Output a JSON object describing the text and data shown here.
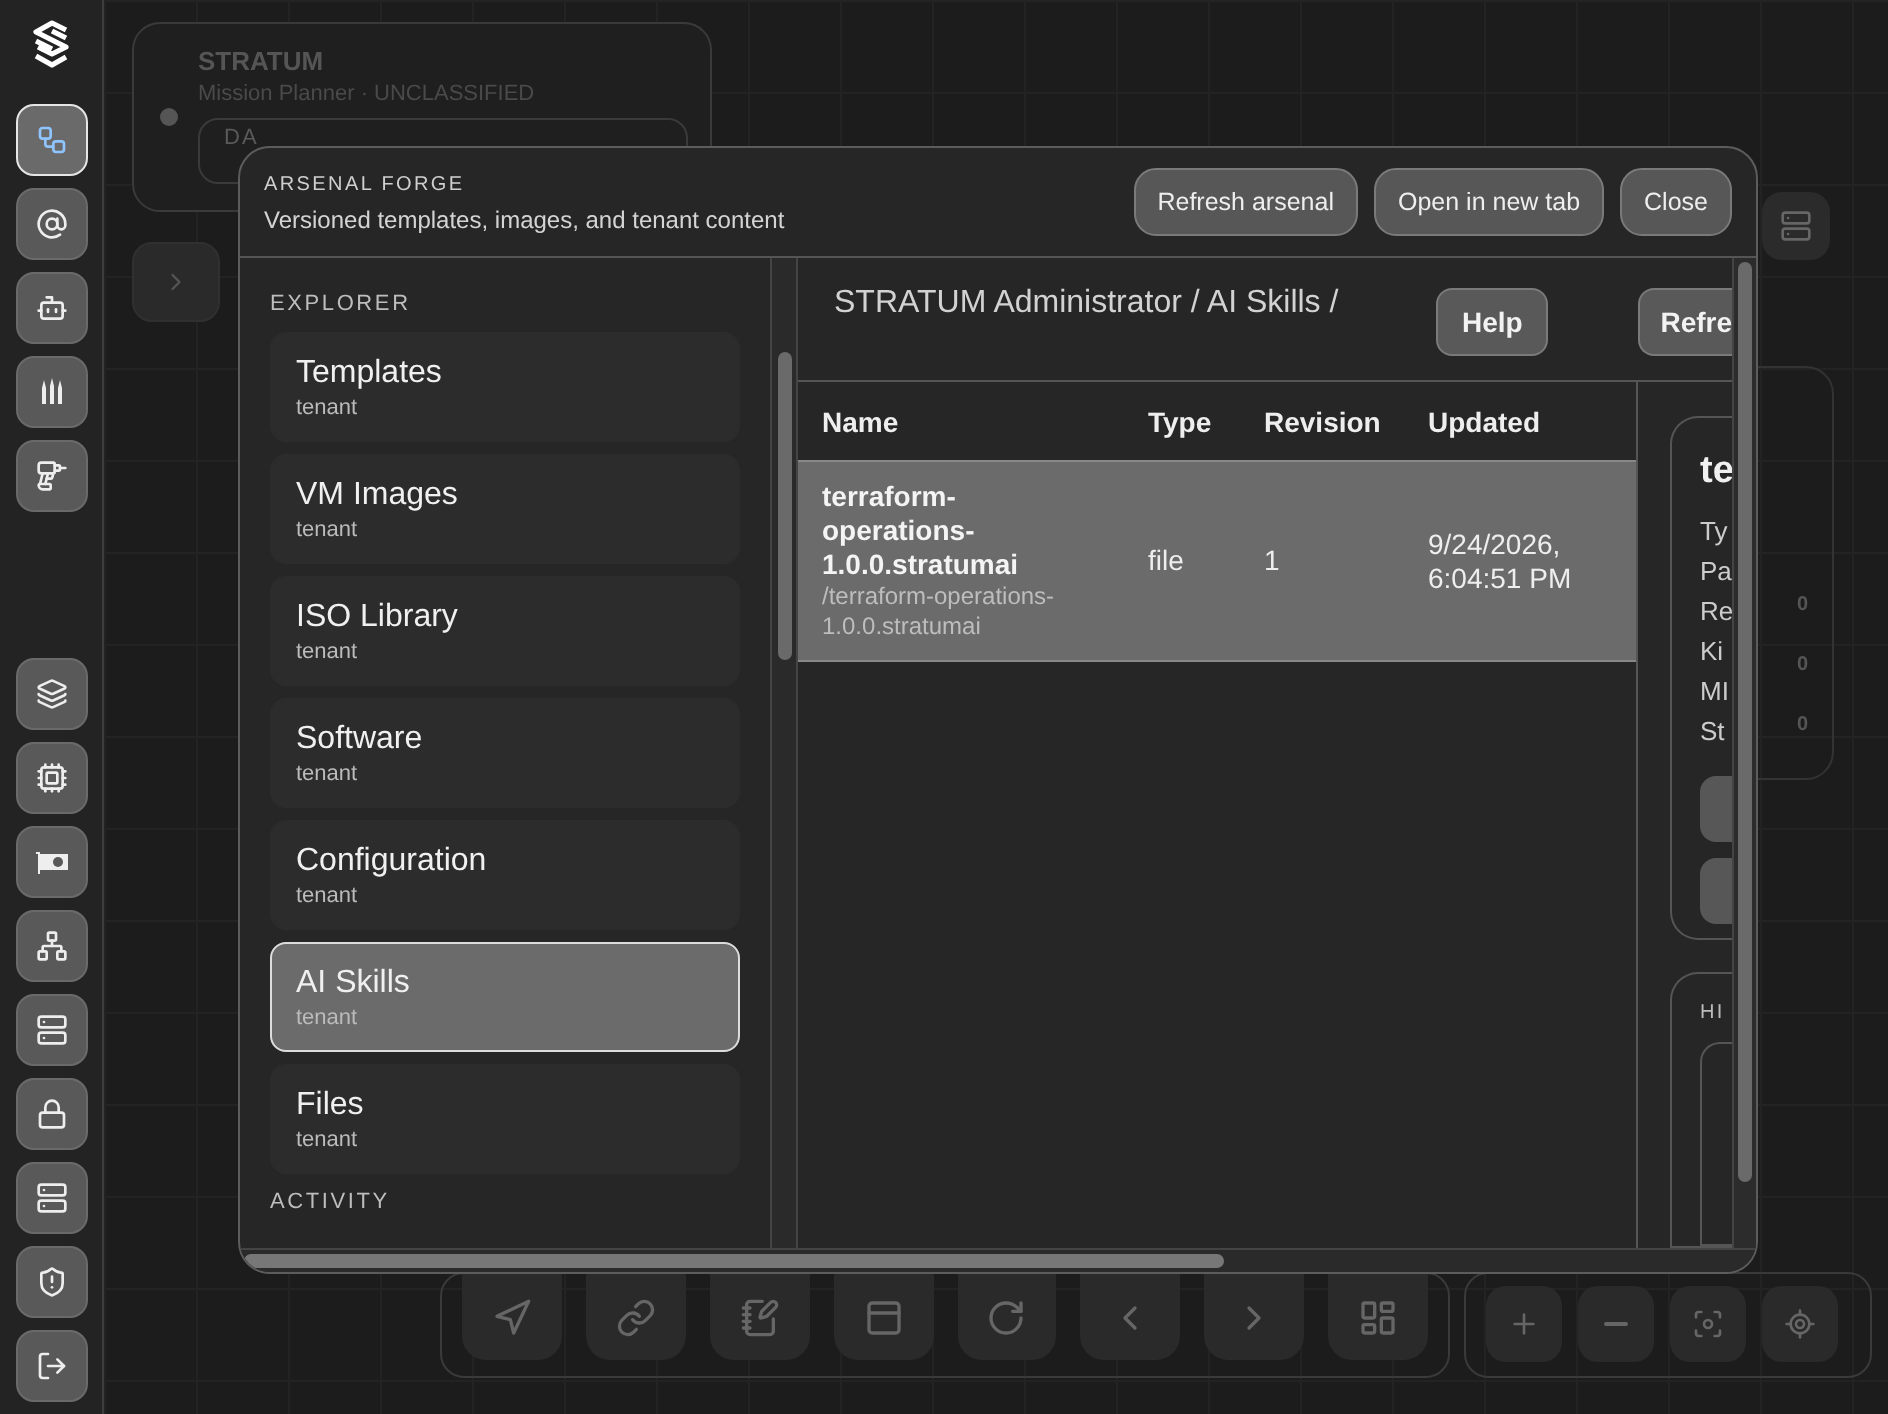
{
  "rail": {
    "items": [
      {
        "selected": true
      },
      {
        "selected": false
      },
      {
        "selected": false
      },
      {
        "selected": false
      },
      {
        "selected": false
      }
    ],
    "bottom_items": [
      {
        "selected": false
      },
      {
        "selected": false
      },
      {
        "selected": false
      },
      {
        "selected": false
      },
      {
        "selected": false
      },
      {
        "selected": false
      },
      {
        "selected": false
      },
      {
        "selected": false
      },
      {
        "selected": false
      }
    ]
  },
  "mission": {
    "title": "STRATUM",
    "subtitle": "Mission Planner · UNCLASSIFIED",
    "field_value": "DA"
  },
  "side_panel": {
    "values": [
      "0",
      "0",
      "0"
    ]
  },
  "modal": {
    "eyebrow": "ARSENAL FORGE",
    "subtitle": "Versioned templates, images, and tenant content",
    "buttons": [
      "Refresh arsenal",
      "Open in new tab",
      "Close"
    ],
    "explorer": {
      "heading": "EXPLORER",
      "items": [
        {
          "label": "Templates",
          "scope": "tenant",
          "selected": false
        },
        {
          "label": "VM Images",
          "scope": "tenant",
          "selected": false
        },
        {
          "label": "ISO Library",
          "scope": "tenant",
          "selected": false
        },
        {
          "label": "Software",
          "scope": "tenant",
          "selected": false
        },
        {
          "label": "Configuration",
          "scope": "tenant",
          "selected": false
        },
        {
          "label": "AI Skills",
          "scope": "tenant",
          "selected": true
        },
        {
          "label": "Files",
          "scope": "tenant",
          "selected": false
        }
      ],
      "activity_heading": "ACTIVITY"
    },
    "breadcrumb": "STRATUM Administrator / AI Skills /",
    "actions": [
      "Help",
      "Refre"
    ],
    "table": {
      "columns": [
        "Name",
        "Type",
        "Revision",
        "Updated"
      ],
      "rows": [
        {
          "name": "terraform-operations-1.0.0.stratumai",
          "path": "/terraform-operations-1.0.0.stratumai",
          "type": "file",
          "revision": "1",
          "updated": "9/24/2026, 6:04:51 PM",
          "selected": true
        }
      ]
    },
    "detail": {
      "title": "te",
      "fields": [
        "Ty",
        "Pa",
        "Re",
        "Ki",
        "MI",
        "St"
      ]
    },
    "history": {
      "heading": "HI"
    }
  }
}
